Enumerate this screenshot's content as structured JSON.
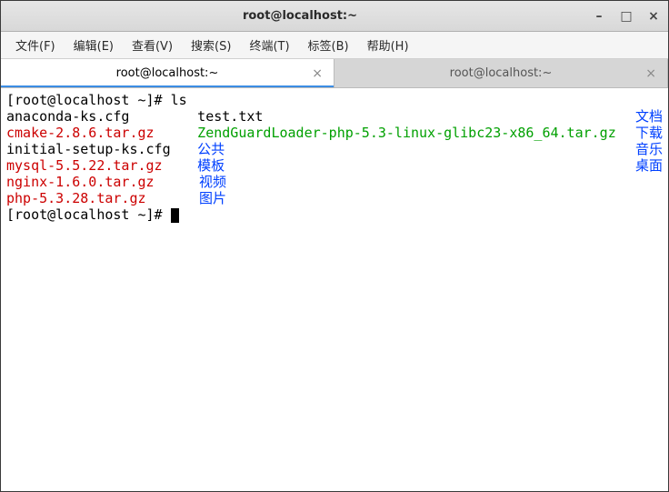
{
  "titlebar": {
    "title": "root@localhost:~"
  },
  "menu": {
    "file": "文件(F)",
    "edit": "编辑(E)",
    "view": "查看(V)",
    "search": "搜索(S)",
    "terminal": "终端(T)",
    "tabs": "标签(B)",
    "help": "帮助(H)"
  },
  "tabs": [
    {
      "label": "root@localhost:~",
      "active": true
    },
    {
      "label": "root@localhost:~",
      "active": false
    }
  ],
  "term": {
    "prompt1": "[root@localhost ~]# ",
    "cmd1": "ls",
    "prompt2": "[root@localhost ~]# ",
    "files": {
      "r1c1": "anaconda-ks.cfg",
      "r1c2": "test.txt",
      "r1c3": "文档",
      "r2c1": "cmake-2.8.6.tar.gz",
      "r2c2": "ZendGuardLoader-php-5.3-linux-glibc23-x86_64.tar.gz",
      "r2c3": "下载",
      "r3c1": "initial-setup-ks.cfg",
      "r3c2": "公共",
      "r3c3": "音乐",
      "r4c1": "mysql-5.5.22.tar.gz",
      "r4c2": "模板",
      "r4c3": "桌面",
      "r5c1": "nginx-1.6.0.tar.gz",
      "r5c2": "视频",
      "r6c1": "php-5.3.28.tar.gz",
      "r6c2": "图片"
    }
  }
}
